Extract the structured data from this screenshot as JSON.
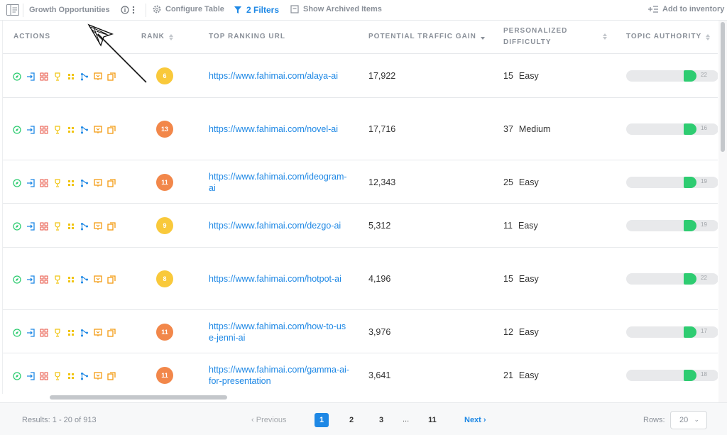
{
  "toolbar": {
    "report_name": "Growth Opportunities",
    "configure_label": "Configure Table",
    "filters_label": "2 Filters",
    "archived_label": "Show Archived Items",
    "add_inventory_label": "Add to inventory"
  },
  "columns": {
    "actions": "ACTIONS",
    "rank": "RANK",
    "url": "TOP RANKING URL",
    "gain": "POTENTIAL TRAFFIC GAIN",
    "difficulty_line1": "PERSONALIZED",
    "difficulty_line2": "DIFFICULTY",
    "authority": "TOPIC AUTHORITY"
  },
  "rows": [
    {
      "rank": "6",
      "rank_color": "#f9c93b",
      "url": "https://www.fahimai.com/alaya-ai",
      "gain": "17,922",
      "difficulty": "15",
      "level": "Easy",
      "authority": "22"
    },
    {
      "rank": "13",
      "rank_color": "#f2874a",
      "url": "https://www.fahimai.com/novel-ai",
      "gain": "17,716",
      "difficulty": "37",
      "level": "Medium",
      "authority": "16"
    },
    {
      "rank": "11",
      "rank_color": "#f2874a",
      "url": "https://www.fahimai.com/ideogram-ai",
      "gain": "12,343",
      "difficulty": "25",
      "level": "Easy",
      "authority": "19"
    },
    {
      "rank": "9",
      "rank_color": "#f9c93b",
      "url": "https://www.fahimai.com/dezgo-ai",
      "gain": "5,312",
      "difficulty": "11",
      "level": "Easy",
      "authority": "19"
    },
    {
      "rank": "8",
      "rank_color": "#f9c93b",
      "url": "https://www.fahimai.com/hotpot-ai",
      "gain": "4,196",
      "difficulty": "15",
      "level": "Easy",
      "authority": "22"
    },
    {
      "rank": "11",
      "rank_color": "#f2874a",
      "url": "https://www.fahimai.com/how-to-use-jenni-ai",
      "gain": "3,976",
      "difficulty": "12",
      "level": "Easy",
      "authority": "17"
    },
    {
      "rank": "11",
      "rank_color": "#f2874a",
      "url": "https://www.fahimai.com/gamma-ai-for-presentation",
      "gain": "3,641",
      "difficulty": "21",
      "level": "Easy",
      "authority": "18"
    }
  ],
  "action_icons": [
    "compass-icon",
    "login-icon",
    "grid-icon",
    "trophy-icon",
    "grid-small-icon",
    "branch-icon",
    "presentation-icon",
    "copy-icon"
  ],
  "footer": {
    "results": "Results: 1 - 20 of 913",
    "previous": "Previous",
    "pages": [
      "1",
      "2",
      "3",
      "11"
    ],
    "ellipsis": "...",
    "next": "Next",
    "rows_label": "Rows:",
    "rows_value": "20"
  },
  "colors": {
    "accent": "#1e88e5",
    "authority_fill": "#2ecc71"
  }
}
